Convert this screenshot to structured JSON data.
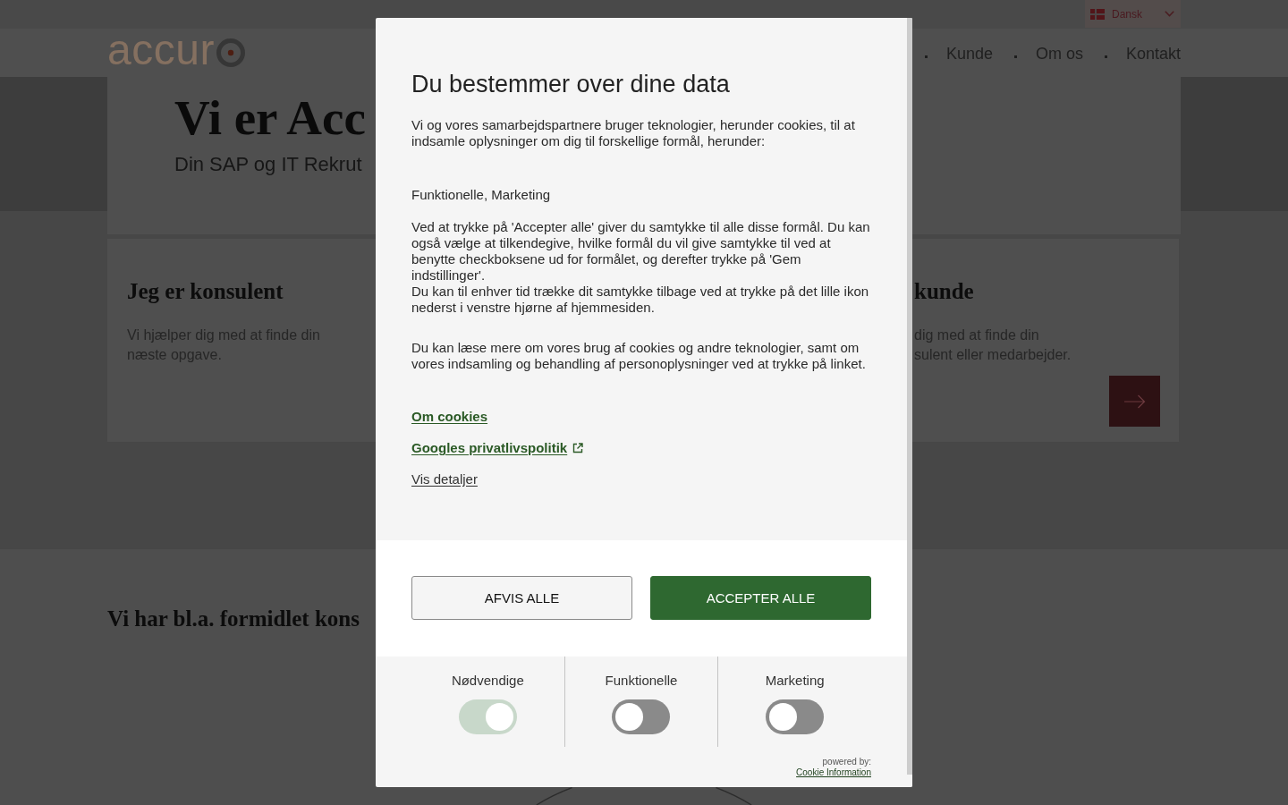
{
  "top_bar": {
    "language": {
      "label": "Dansk"
    }
  },
  "header": {
    "logo": {
      "text": "accur"
    },
    "nav": [
      {
        "label": "Kunde"
      },
      {
        "label": "Om os"
      },
      {
        "label": "Kontakt"
      }
    ]
  },
  "hero": {
    "title": "Vi er Acc",
    "subtitle": "Din SAP og IT Rekrut"
  },
  "cards": [
    {
      "title": "Jeg er konsulent",
      "lines": [
        "Vi hjælper dig med at finde din",
        "næste opgave."
      ],
      "arrow_button": false
    },
    {
      "title": "kunde",
      "lines": [
        "dig med at finde din",
        "sulent eller medarbejder."
      ],
      "arrow_button": true
    }
  ],
  "section_heading": "Vi har bl.a. formidlet kons",
  "consent": {
    "title": "Du bestemmer over dine data",
    "intro": "Vi og vores samarbejdspartnere bruger teknologier, herunder cookies, til at indsamle oplysninger om dig til forskellige formål, herunder:",
    "purposes": "Funktionelle, Marketing",
    "consent_text": "Ved at trykke på 'Accepter alle' giver du samtykke til alle disse formål. Du kan også vælge at tilkendegive, hvilke formål du vil give samtykke til ved at benytte checkboksene ud for formålet, og derefter trykke på 'Gem indstillinger'.",
    "withdraw_text": "Du kan til enhver tid trække dit samtykke tilbage ved at trykke på det lille ikon nederst i venstre hjørne af hjemmesiden.",
    "more_text": "Du kan læse mere om vores brug af cookies og andre teknologier, samt om vores indsamling og behandling af personoplysninger ved at trykke på linket.",
    "links": [
      {
        "label": "Om cookies",
        "kind": "primary"
      },
      {
        "label": "Googles privatlivspolitik",
        "kind": "external"
      },
      {
        "label": "Vis detaljer",
        "kind": "plain"
      }
    ],
    "buttons": [
      {
        "label": "AFVIS ALLE",
        "kind": "secondary"
      },
      {
        "label": "ACCEPTER ALLE",
        "kind": "primary"
      }
    ],
    "categories": [
      {
        "label": "Nødvendige",
        "on": true,
        "disabled": true
      },
      {
        "label": "Funktionelle",
        "on": false,
        "disabled": false
      },
      {
        "label": "Marketing",
        "on": false,
        "disabled": false
      }
    ],
    "powered_by": "powered by:",
    "provider_link": "Cookie Information"
  }
}
